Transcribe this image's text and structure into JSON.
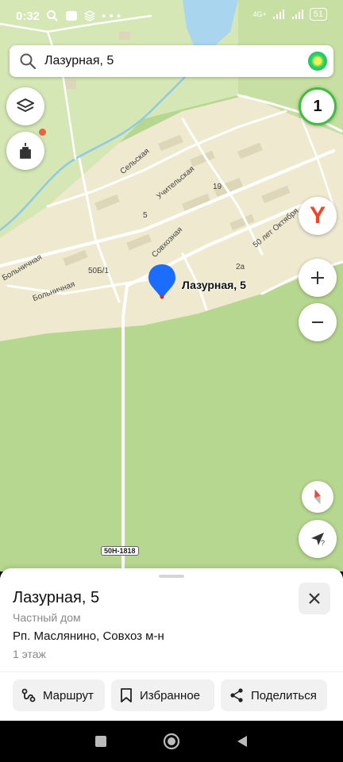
{
  "status_bar": {
    "time": "0:32",
    "network": "4G+",
    "battery": "51"
  },
  "search": {
    "query": "Лазурная, 5"
  },
  "map": {
    "counter": "1",
    "place_label": "Лазурная, 5",
    "road_labels": [
      "Сельская",
      "Учительская",
      "Совхозная",
      "Больничная",
      "Больничная",
      "50 лет Октября",
      "50Б/1",
      "19",
      "2а",
      "5"
    ],
    "highway": "50Н-1818",
    "yandex_letter": "Y"
  },
  "card": {
    "title": "Лазурная, 5",
    "type": "Частный дом",
    "address": "Рп. Маслянино, Совхоз м-н",
    "floors": "1 этаж"
  },
  "actions": {
    "route": "Маршрут",
    "favorites": "Избранное",
    "share": "Поделиться"
  },
  "colors": {
    "forest": "#b6d78f",
    "residential": "#efe9cf",
    "pin": "#1a6dff",
    "counter_ring": "#3fbf3f",
    "yandex_red": "#fc3f1d"
  }
}
